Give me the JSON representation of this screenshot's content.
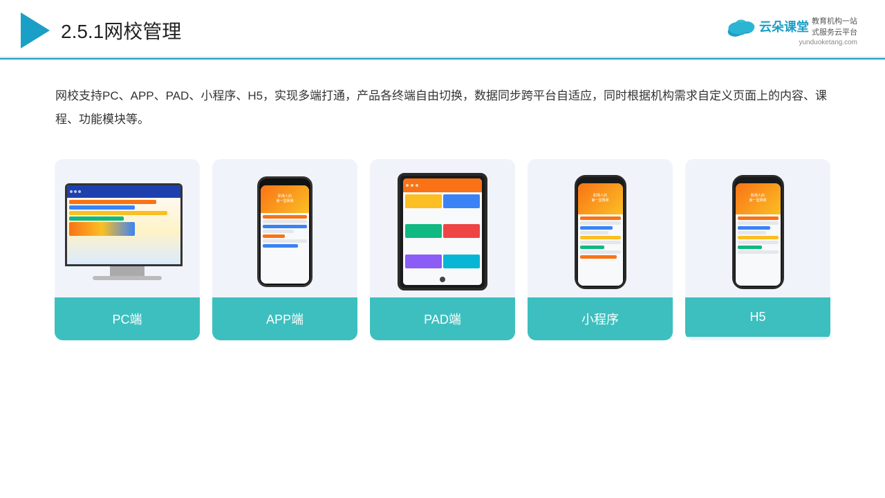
{
  "header": {
    "title_prefix": "2.5.1",
    "title_main": "网校管理",
    "logo_cn": "云朵课堂",
    "logo_en": "yunduoketang.com",
    "logo_tagline_line1": "教育机构一站",
    "logo_tagline_line2": "式服务云平台"
  },
  "description": {
    "text": "网校支持PC、APP、PAD、小程序、H5，实现多端打通，产品各终端自由切换，数据同步跨平台自适应，同时根据机构需求自定义页面上的内容、课程、功能模块等。"
  },
  "cards": [
    {
      "id": "pc",
      "label": "PC端"
    },
    {
      "id": "app",
      "label": "APP端"
    },
    {
      "id": "pad",
      "label": "PAD端"
    },
    {
      "id": "miniprogram",
      "label": "小程序"
    },
    {
      "id": "h5",
      "label": "H5"
    }
  ],
  "colors": {
    "accent": "#3dbfbf",
    "header_line": "#1a9fc7",
    "card_bg": "#f0f4fa"
  }
}
